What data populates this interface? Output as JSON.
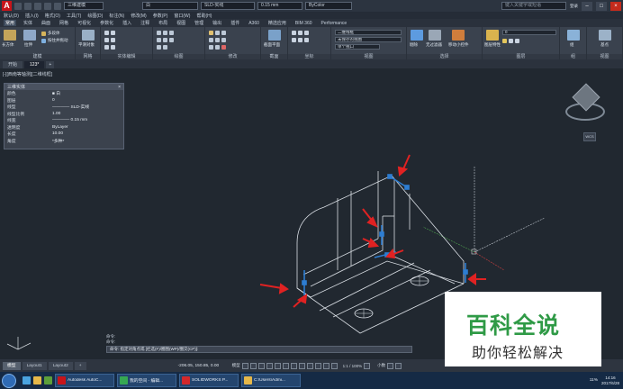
{
  "titlebar": {
    "app_name": "AutoCAD 2014",
    "workspace": "三维建模",
    "layer": "白",
    "linetype": "SLD-实线",
    "lineweight": "0.15 mm",
    "color": "ByColor",
    "search_placeholder": "键入关键字或短语",
    "signin": "登录",
    "cloud": "联机上传"
  },
  "menubar": [
    "默认(D)",
    "插入(I)",
    "格式(O)",
    "工具(T)",
    "绘图(D)",
    "标注(N)",
    "修改(M)",
    "参数(P)",
    "窗口(W)",
    "帮助(H)"
  ],
  "ribbon_tabs": [
    {
      "label": "常用",
      "active": true
    },
    {
      "label": "实体",
      "active": false
    },
    {
      "label": "曲面",
      "active": false
    },
    {
      "label": "网格",
      "active": false
    },
    {
      "label": "可视化",
      "active": false
    },
    {
      "label": "参数化",
      "active": false
    },
    {
      "label": "插入",
      "active": false
    },
    {
      "label": "注释",
      "active": false
    },
    {
      "label": "布局",
      "active": false
    },
    {
      "label": "视图",
      "active": false
    },
    {
      "label": "管理",
      "active": false
    },
    {
      "label": "输出",
      "active": false
    },
    {
      "label": "插件",
      "active": false
    },
    {
      "label": "A360",
      "active": false
    },
    {
      "label": "精选应用",
      "active": false
    },
    {
      "label": "BIM 360",
      "active": false
    },
    {
      "label": "Performance",
      "active": false
    }
  ],
  "ribbon": {
    "panels": [
      "建模",
      "网格",
      "实体编辑",
      "绘图",
      "修改",
      "截面",
      "坐标",
      "视图",
      "选择",
      "图层",
      "组",
      "视图"
    ],
    "tools": {
      "box": "长方体",
      "extrude": "拉伸",
      "smooth": "平滑对象",
      "polysolid": "多段体",
      "presspull": "按住并拖动",
      "section_plane": "截面平面",
      "culling": "剔除",
      "no_filter": "无过滤器",
      "move_gizmo": "移动小控件",
      "layer_props": "图层特性",
      "group": "组",
      "base": "基点"
    },
    "visual_style": "二维线框",
    "view_combo": "未保存的视图",
    "single_viewport": "单个视口",
    "layer_value": "0"
  },
  "file_tabs": [
    {
      "label": "开始",
      "active": false
    },
    {
      "label": "123*",
      "active": true
    },
    {
      "label": "+",
      "active": false
    }
  ],
  "view_label": "[-][西南等轴测][二维线框]",
  "properties": {
    "title": "三维实体",
    "rows": [
      {
        "k": "颜色",
        "v": "■ 白"
      },
      {
        "k": "图层",
        "v": "0"
      },
      {
        "k": "线型",
        "v": "———— SLD-实线"
      },
      {
        "k": "线型比例",
        "v": "1.00"
      },
      {
        "k": "线宽",
        "v": "———— 0.15 mm"
      },
      {
        "k": "透明度",
        "v": "ByLayer"
      },
      {
        "k": "长度",
        "v": "10.00"
      },
      {
        "k": "角度",
        "v": "*多种*"
      }
    ]
  },
  "viewcube": {
    "label": "WCS"
  },
  "command": {
    "history": [
      "命令:",
      "命令:"
    ],
    "prompt": "命令: 指定对角点或 [栏选(F)/圈围(WP)/圈交(CP)]:"
  },
  "status": {
    "layout_tabs": [
      {
        "label": "模型",
        "active": true
      },
      {
        "label": "Layout1",
        "active": false
      },
      {
        "label": "Layout2",
        "active": false
      }
    ],
    "coords": "-206.05, 150.85, 0.00",
    "model": "模型",
    "scale": "1:1 / 100%",
    "units": "小数"
  },
  "taskbar": {
    "apps": [
      {
        "label": "Autodesk AutoC..."
      },
      {
        "label": "我的空间 - 编辑..."
      },
      {
        "label": "SOLIDWORKS P..."
      },
      {
        "label": "C:\\Users\\Admi..."
      }
    ],
    "time": "14:16",
    "date": "2017/6/28",
    "net": "11%"
  },
  "watermark": {
    "title": "百科全说",
    "subtitle": "助你轻松解决"
  },
  "colors": {
    "accent": "#c8141a",
    "arrow": "#e02222",
    "grip": "#2d7dd2",
    "wm_green": "#2f9a46"
  }
}
